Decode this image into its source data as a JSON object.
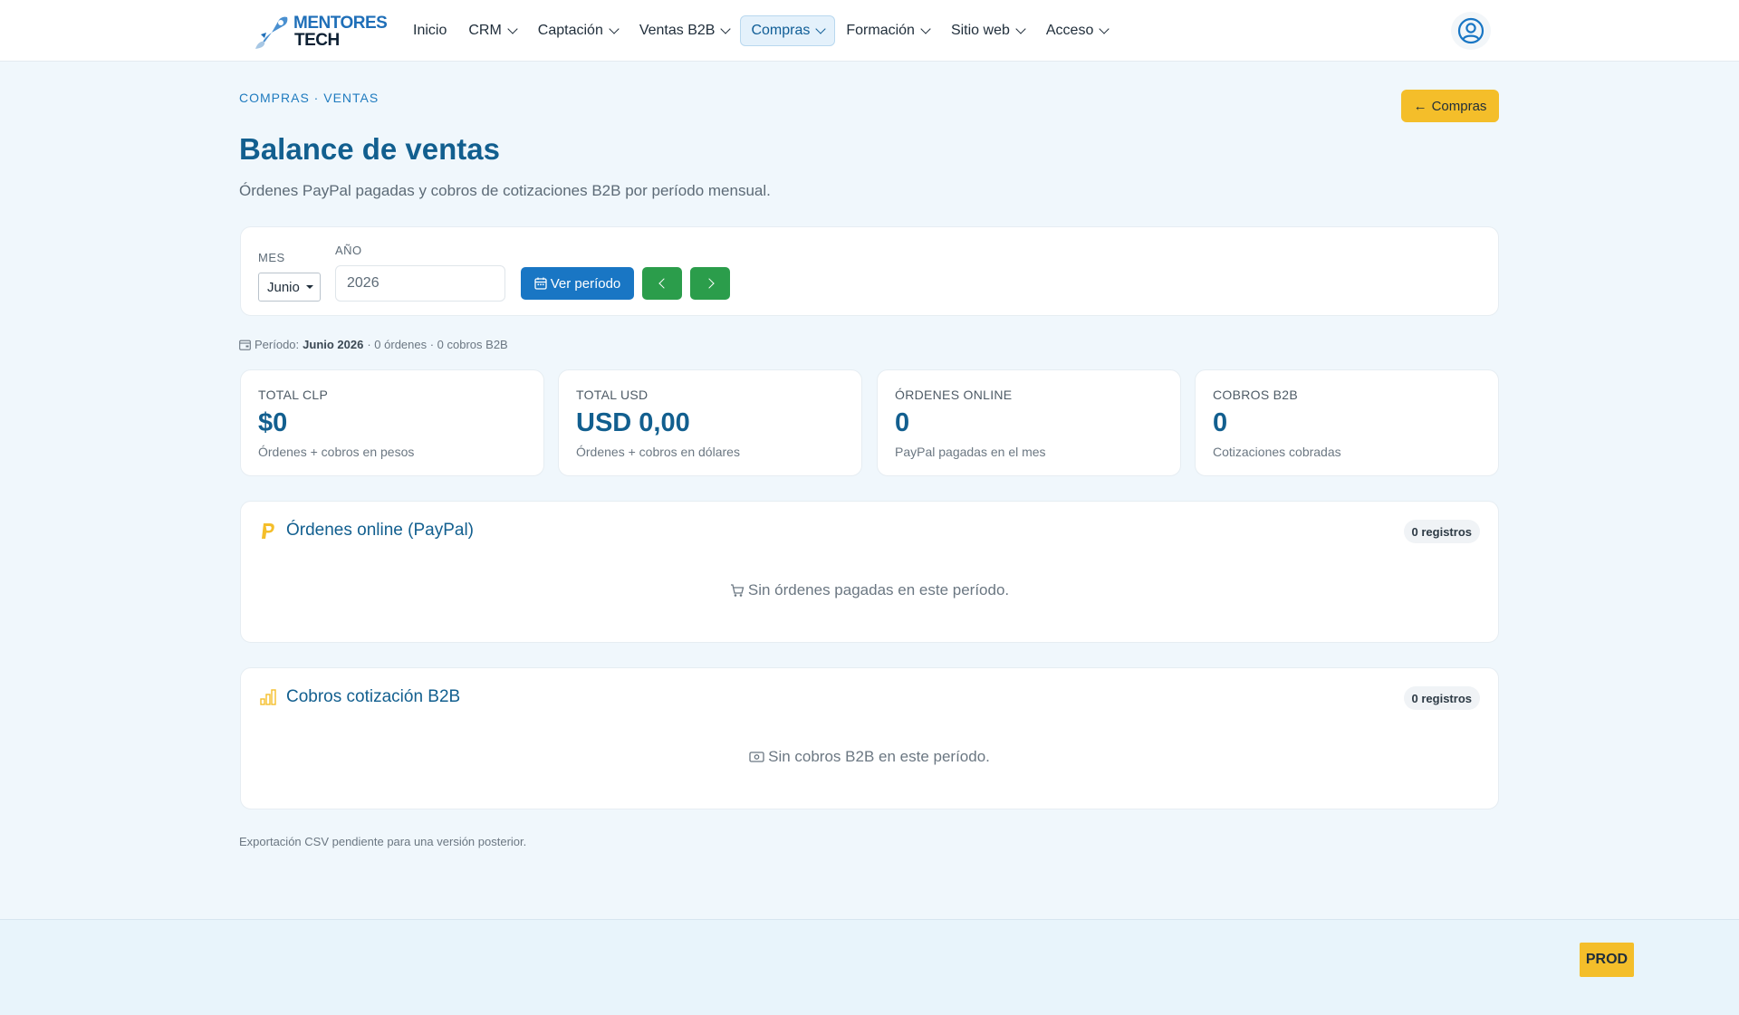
{
  "brand": {
    "line1": "MENTORES",
    "line2": "TECH"
  },
  "nav": {
    "items": [
      {
        "label": "Inicio",
        "dropdown": false,
        "active": false
      },
      {
        "label": "CRM",
        "dropdown": true,
        "active": false
      },
      {
        "label": "Captación",
        "dropdown": true,
        "active": false
      },
      {
        "label": "Ventas B2B",
        "dropdown": true,
        "active": false
      },
      {
        "label": "Compras",
        "dropdown": true,
        "active": true
      },
      {
        "label": "Formación",
        "dropdown": true,
        "active": false
      },
      {
        "label": "Sitio web",
        "dropdown": true,
        "active": false
      },
      {
        "label": "Acceso",
        "dropdown": true,
        "active": false
      }
    ],
    "user_icon": "user-circle-icon"
  },
  "breadcrumb": "COMPRAS · VENTAS",
  "back_button": {
    "label": "Compras",
    "icon": "arrow-left-icon"
  },
  "page": {
    "title": "Balance de ventas",
    "subtitle": "Órdenes PayPal pagadas y cobros de cotizaciones B2B por período mensual."
  },
  "filter": {
    "mes_label": "MES",
    "mes_value": "Junio",
    "anio_label": "AÑO",
    "anio_value": "2026",
    "ver_label": "Ver período",
    "prev_icon": "chevron-left-icon",
    "next_icon": "chevron-right-icon"
  },
  "period": {
    "prefix": "Período:",
    "value": "Junio 2026",
    "suffix": "· 0 órdenes · 0 cobros B2B"
  },
  "stats": [
    {
      "label": "TOTAL CLP",
      "value": "$0",
      "desc": "Órdenes + cobros en pesos"
    },
    {
      "label": "TOTAL USD",
      "value": "USD 0,00",
      "desc": "Órdenes + cobros en dólares"
    },
    {
      "label": "ÓRDENES ONLINE",
      "value": "0",
      "desc": "PayPal pagadas en el mes"
    },
    {
      "label": "COBROS B2B",
      "value": "0",
      "desc": "Cotizaciones cobradas"
    }
  ],
  "sections": {
    "paypal": {
      "title": "Órdenes online (PayPal)",
      "badge": "0 registros",
      "empty": "Sin órdenes pagadas en este período."
    },
    "b2b": {
      "title": "Cobros cotización B2B",
      "badge": "0 registros",
      "empty": "Sin cobros B2B en este período."
    }
  },
  "footer_note": "Exportación CSV pendiente para una versión posterior.",
  "env_badge": "PROD",
  "colors": {
    "primary": "#125f8f",
    "accent_yellow": "#f4be2a",
    "button_blue": "#1976c4",
    "button_green": "#2b9d4b"
  }
}
